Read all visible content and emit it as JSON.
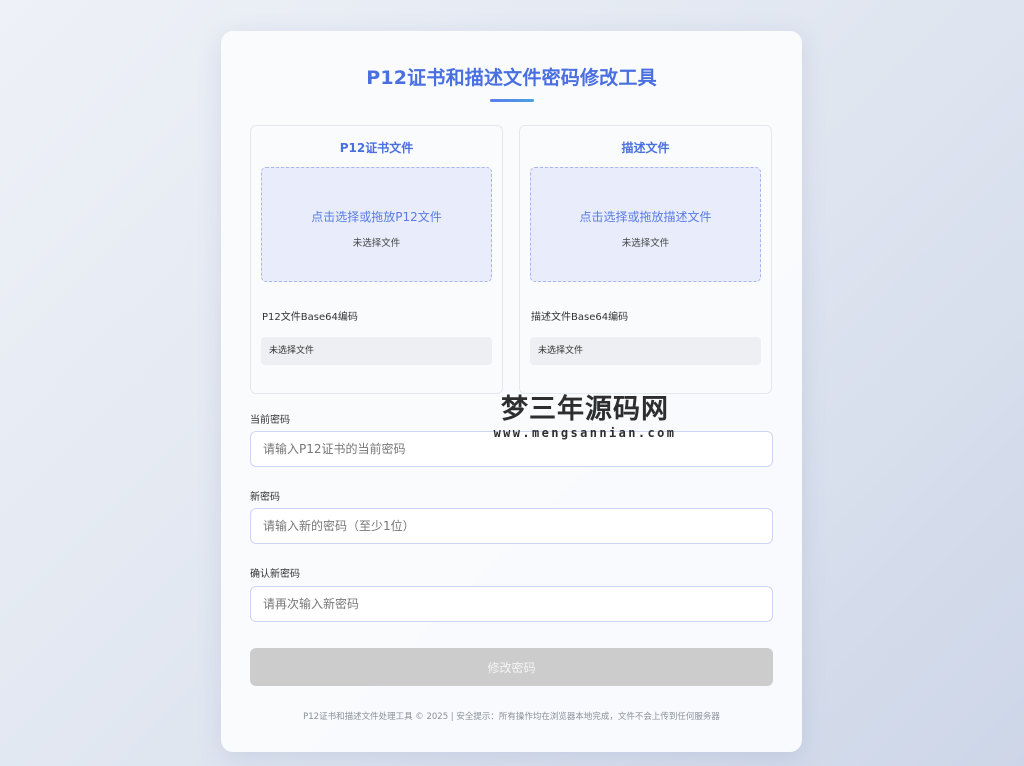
{
  "header": {
    "title": "P12证书和描述文件密码修改工具"
  },
  "p12_panel": {
    "title": "P12证书文件",
    "drop_text": "点击选择或拖放P12文件",
    "file_status": "未选择文件",
    "base64_label": "P12文件Base64编码",
    "base64_value": "未选择文件"
  },
  "profile_panel": {
    "title": "描述文件",
    "drop_text": "点击选择或拖放描述文件",
    "file_status": "未选择文件",
    "base64_label": "描述文件Base64编码",
    "base64_value": "未选择文件"
  },
  "form": {
    "current_password_label": "当前密码",
    "current_password_placeholder": "请输入P12证书的当前密码",
    "new_password_label": "新密码",
    "new_password_placeholder": "请输入新的密码（至少1位）",
    "confirm_password_label": "确认新密码",
    "confirm_password_placeholder": "请再次输入新密码",
    "submit_label": "修改密码"
  },
  "footer": {
    "text": "P12证书和描述文件处理工具 © 2025 | 安全提示：所有操作均在浏览器本地完成，文件不会上传到任何服务器"
  },
  "watermark": {
    "main": "梦三年源码网",
    "url": "www.mengsannian.com"
  },
  "colors": {
    "accent": "#4a6fe0",
    "dropzone_bg": "#e8ecfb",
    "dropzone_border": "#a8b6ec",
    "button_disabled": "#cccccc"
  }
}
